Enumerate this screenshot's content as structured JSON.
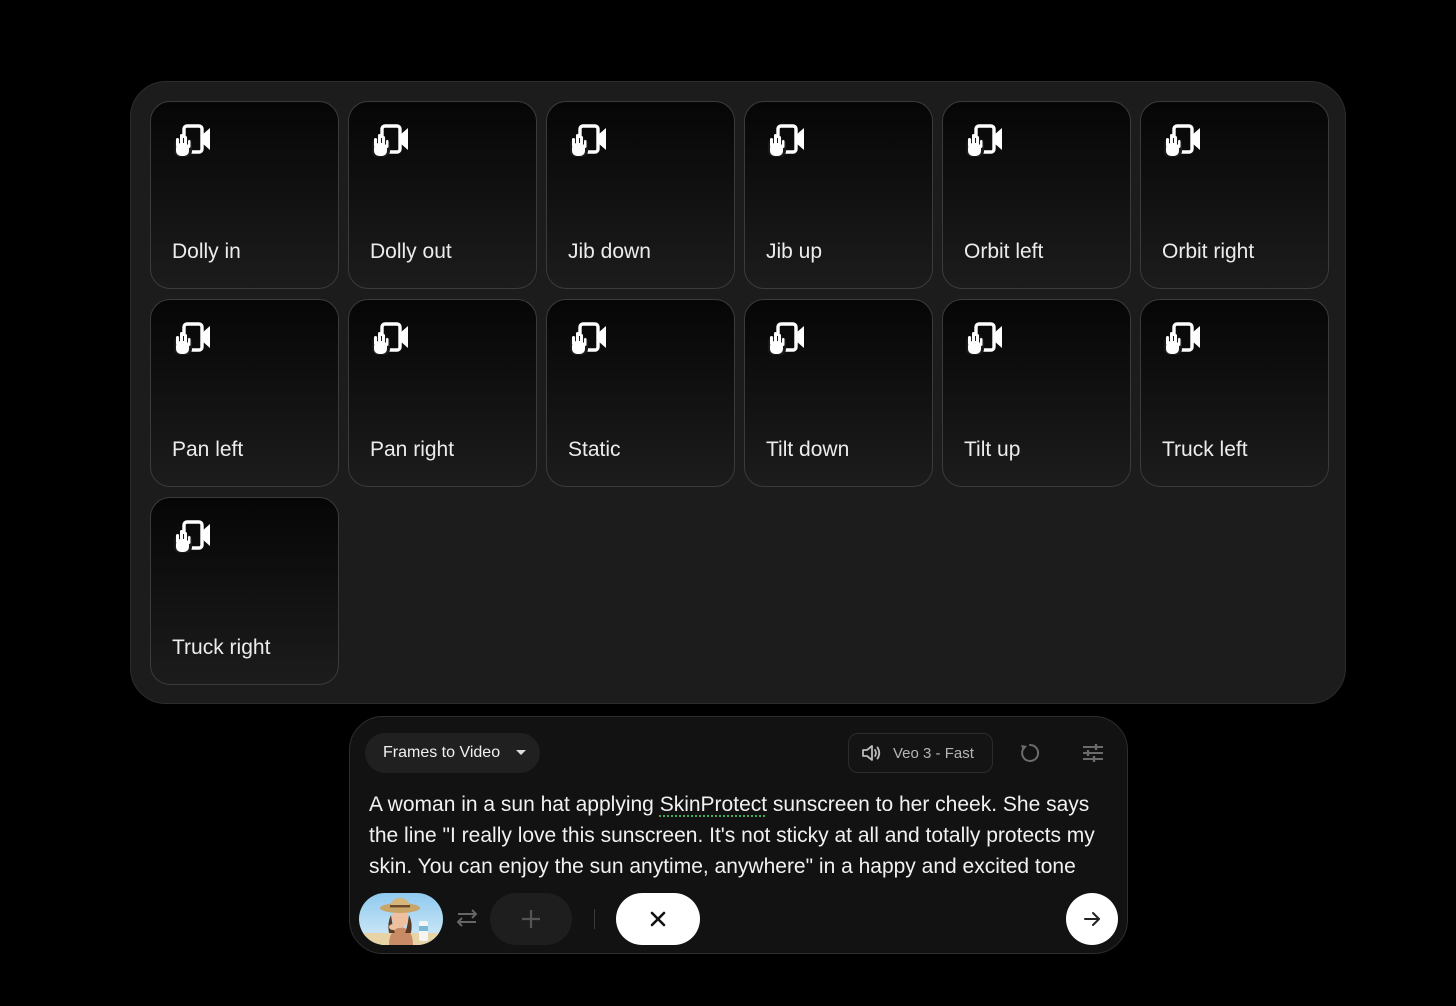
{
  "motions": [
    {
      "label": "Dolly in"
    },
    {
      "label": "Dolly out"
    },
    {
      "label": "Jib down"
    },
    {
      "label": "Jib up"
    },
    {
      "label": "Orbit left"
    },
    {
      "label": "Orbit right"
    },
    {
      "label": "Pan left"
    },
    {
      "label": "Pan right"
    },
    {
      "label": "Static"
    },
    {
      "label": "Tilt down"
    },
    {
      "label": "Tilt up"
    },
    {
      "label": "Truck left"
    },
    {
      "label": "Truck right"
    }
  ],
  "composer": {
    "mode": "Frames to Video",
    "model": "Veo 3 - Fast",
    "prompt_before": "A woman in a sun hat applying ",
    "prompt_flagged_word": "SkinProtect",
    "prompt_after": " sunscreen to her cheek. She says the line \"I really love this sunscreen. It's not sticky at all and totally protects my skin. You can enjoy the sun anytime, anywhere\" in a happy and excited tone"
  },
  "icons": {
    "tile": "camera-motion-icon",
    "audio": "speaker-icon",
    "refresh": "refresh-icon",
    "settings": "sliders-icon",
    "swap": "swap-arrows-icon",
    "add": "plus-icon",
    "close": "close-icon",
    "send": "arrow-right-icon"
  }
}
